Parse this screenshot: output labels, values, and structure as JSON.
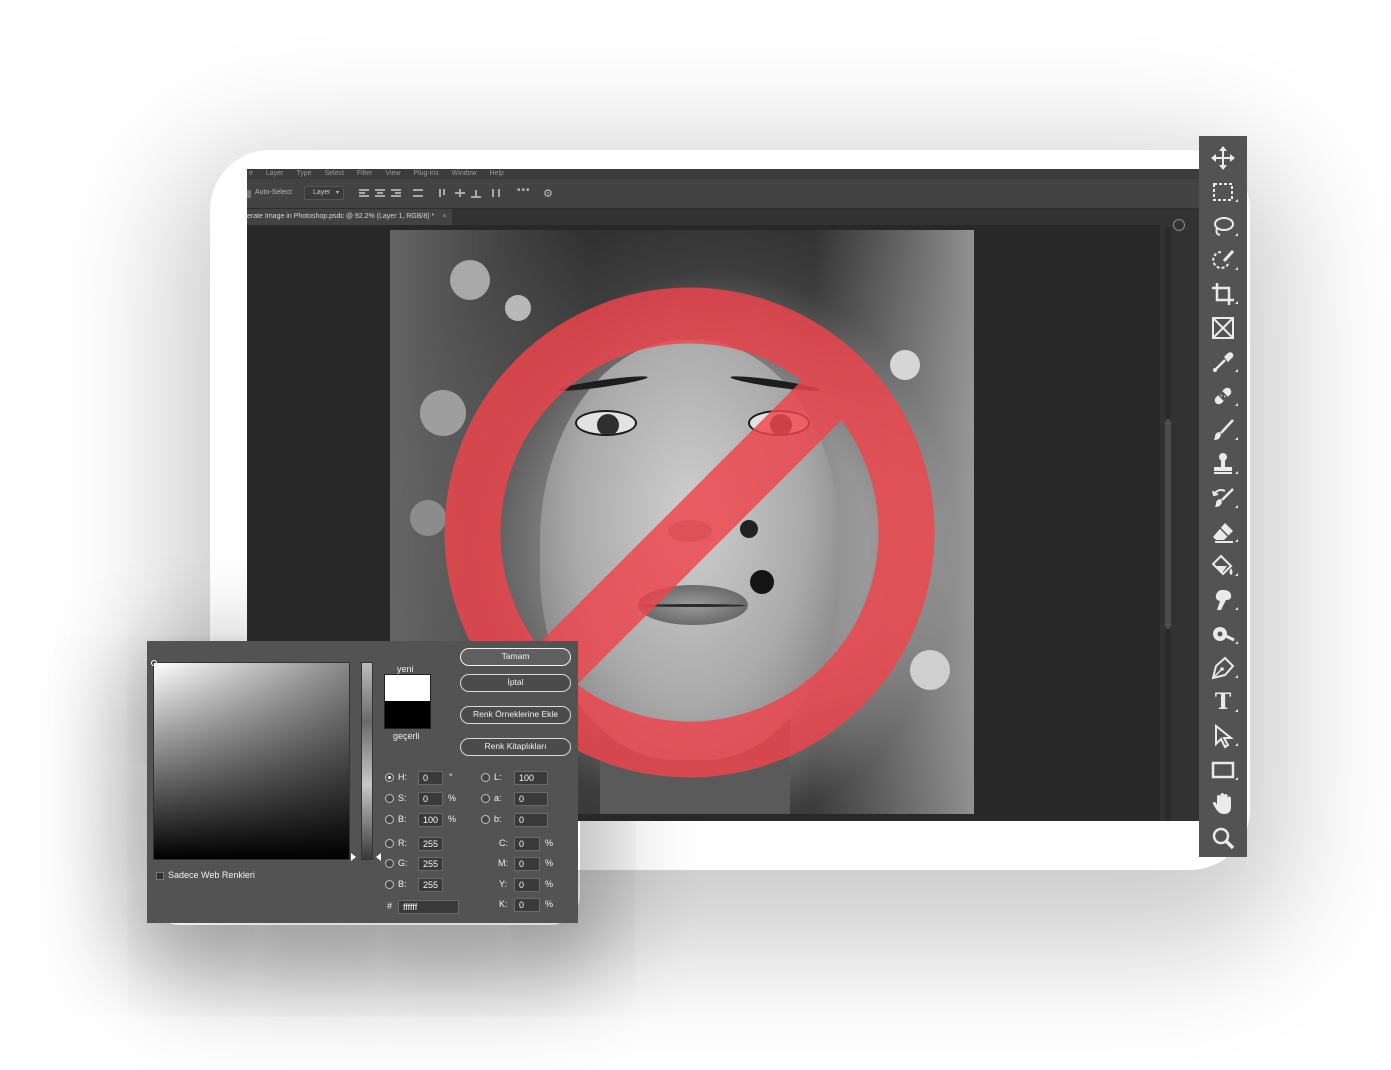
{
  "menubar": {
    "items": [
      "e",
      "Layer",
      "Type",
      "Select",
      "Filter",
      "View",
      "Plug-ins",
      "Window",
      "Help"
    ]
  },
  "options_bar": {
    "auto_select_label": "Auto-Select:",
    "layer_dropdown": "Layer",
    "more": "•••"
  },
  "document_tab": {
    "title": "erate Image in Photoshop.psdc @ 92.2% (Layer 1, RGB/8) *",
    "close": "×"
  },
  "color_picker": {
    "new_label": "yeni",
    "current_label": "geçerli",
    "new_color": "#ffffff",
    "current_color": "#000000",
    "buttons": {
      "ok": "Tamam",
      "cancel": "İptal",
      "add_to_swatches": "Renk Örneklerine Ekle",
      "color_libraries": "Renk Kitaplıkları"
    },
    "web_colors_only": "Sadece Web Renkleri",
    "hsb": {
      "h": {
        "label": "H:",
        "value": "0",
        "unit": "°"
      },
      "s": {
        "label": "S:",
        "value": "0",
        "unit": "%"
      },
      "b": {
        "label": "B:",
        "value": "100",
        "unit": "%"
      }
    },
    "rgb": {
      "r": {
        "label": "R:",
        "value": "255"
      },
      "g": {
        "label": "G:",
        "value": "255"
      },
      "b": {
        "label": "B:",
        "value": "255"
      }
    },
    "lab": {
      "l": {
        "label": "L:",
        "value": "100"
      },
      "a": {
        "label": "a:",
        "value": "0"
      },
      "b": {
        "label": "b:",
        "value": "0"
      }
    },
    "cmyk": {
      "c": {
        "label": "C:",
        "value": "0",
        "unit": "%"
      },
      "m": {
        "label": "M:",
        "value": "0",
        "unit": "%"
      },
      "y": {
        "label": "Y:",
        "value": "0",
        "unit": "%"
      },
      "k": {
        "label": "K:",
        "value": "0",
        "unit": "%"
      }
    },
    "hex": {
      "label": "#",
      "value": "ffffff"
    }
  },
  "prohibition_color": "#f0444c",
  "tools": [
    "move-tool-icon",
    "rectangular-marquee-icon",
    "lasso-icon",
    "object-selection-icon",
    "crop-tool-icon",
    "frame-tool-icon",
    "eyedropper-icon",
    "healing-brush-icon",
    "brush-tool-icon",
    "clone-stamp-icon",
    "history-brush-icon",
    "eraser-icon",
    "paint-bucket-icon",
    "smudge-tool-icon",
    "dodge-tool-icon",
    "pen-tool-icon",
    "type-tool-icon",
    "path-selection-icon",
    "rectangle-tool-icon",
    "hand-tool-icon",
    "zoom-tool-icon"
  ],
  "type_tool_glyph": "T"
}
